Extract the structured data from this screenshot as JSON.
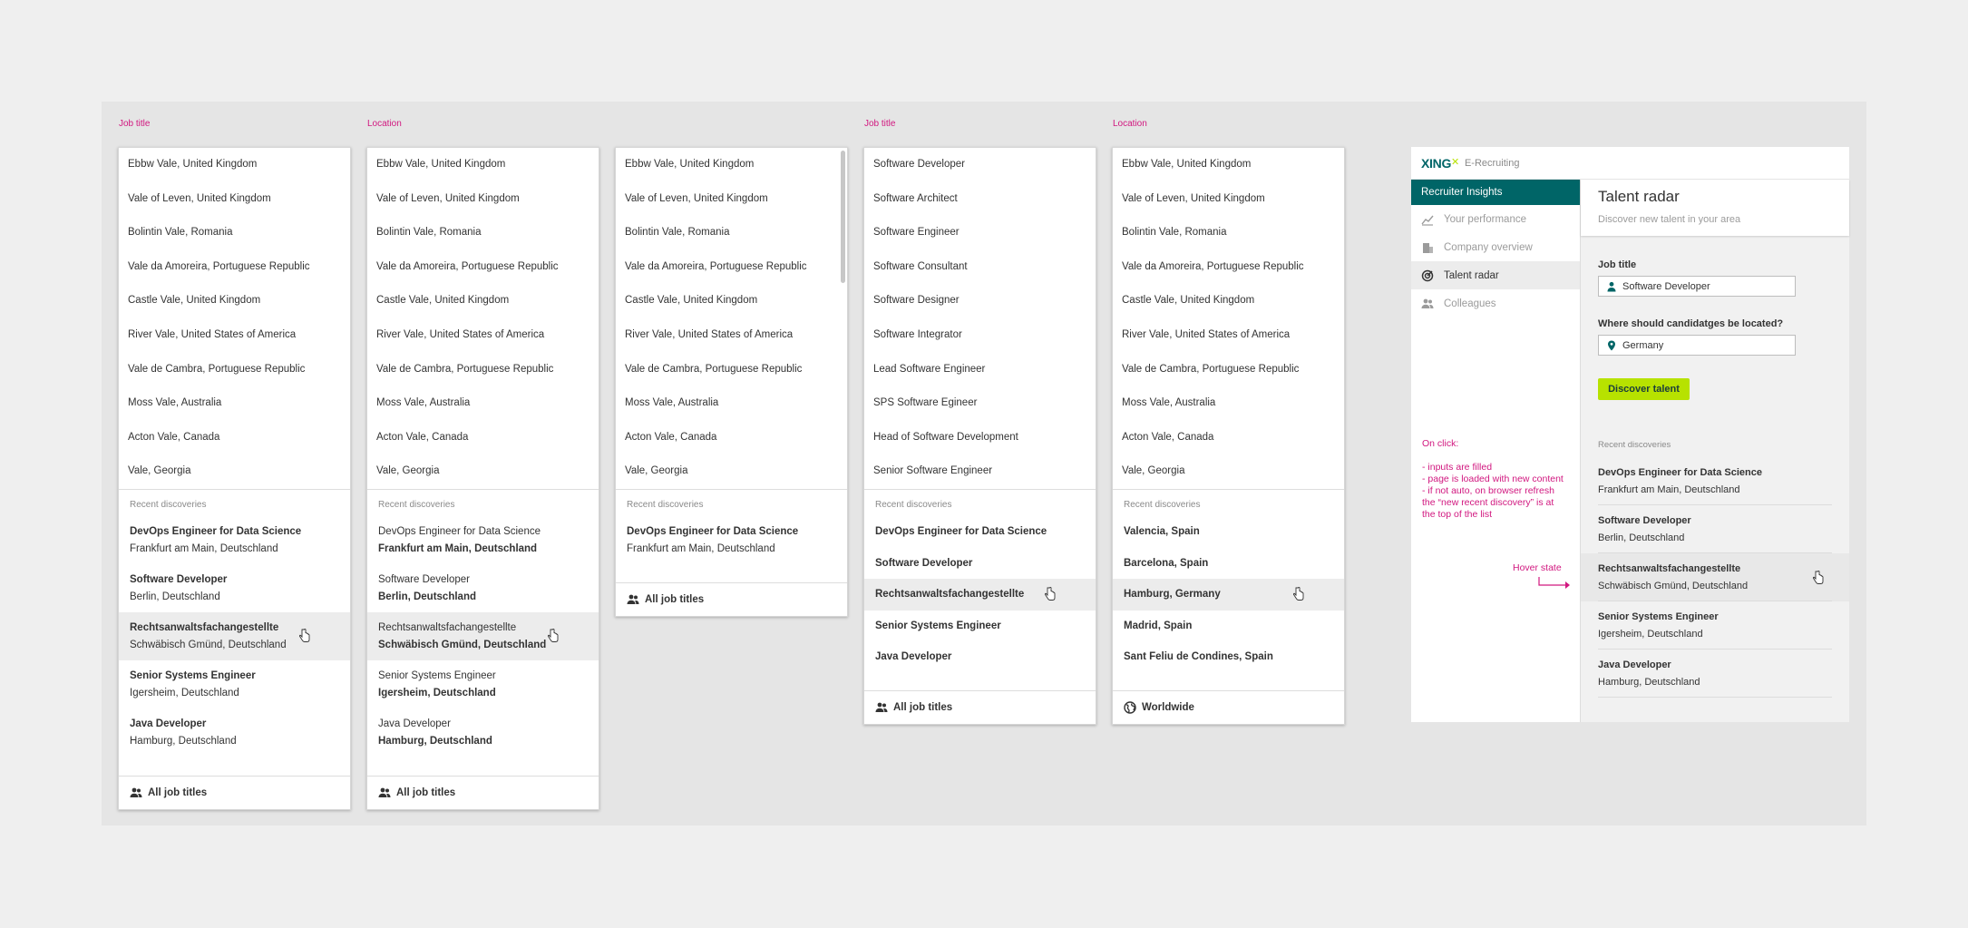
{
  "colors": {
    "annotation": "#d1177f",
    "brand_teal": "#006567",
    "brand_green": "#b7e200"
  },
  "labels": {
    "p1": "Job title",
    "p2": "Location",
    "p4": "Job title",
    "p5": "Location"
  },
  "locations": [
    "Ebbw Vale, United Kingdom",
    "Vale of Leven, United Kingdom",
    "Bolintin Vale, Romania",
    "Vale da Amoreira, Portuguese Republic",
    "Castle Vale, United Kingdom",
    "River Vale, United States of America",
    "Vale de Cambra, Portuguese Republic",
    "Moss Vale, Australia",
    "Acton Vale, Canada",
    "Vale, Georgia"
  ],
  "job_options": [
    "Software Developer",
    "Software Architect",
    "Software Engineer",
    "Software Consultant",
    "Software Designer",
    "Software Integrator",
    "Lead Software Engineer",
    "SPS Software Egineer",
    "Head of Software Development",
    "Senior Software Engineer"
  ],
  "recent_title": "Recent discoveries",
  "recent": [
    {
      "title": "DevOps Engineer for Data Science",
      "place": "Frankfurt am Main, Deutschland"
    },
    {
      "title": "Software Developer",
      "place": "Berlin, Deutschland"
    },
    {
      "title": "Rechtsanwaltsfachangestellte",
      "place": "Schwäbisch Gmünd, Deutschland"
    },
    {
      "title": "Senior Systems Engineer",
      "place": "Igersheim, Deutschland"
    },
    {
      "title": "Java Developer",
      "place": "Hamburg, Deutschland"
    }
  ],
  "recent_jobs_single": [
    "DevOps Engineer for Data Science",
    "Software Developer",
    "Rechtsanwaltsfachangestellte",
    "Senior Systems Engineer",
    "Java Developer"
  ],
  "recent_locations_single": [
    "Valencia, Spain",
    "Barcelona, Spain",
    "Hamburg, Germany",
    "Madrid, Spain",
    "Sant Feliu de Condines, Spain"
  ],
  "footer": {
    "all_jobs": "All job titles",
    "worldwide": "Worldwide"
  },
  "app": {
    "logo": "XING",
    "product": "E-Recruiting",
    "section": "Recruiter Insights",
    "nav": [
      {
        "label": "Your performance",
        "icon": "chart-icon"
      },
      {
        "label": "Company overview",
        "icon": "building-icon"
      },
      {
        "label": "Talent radar",
        "icon": "radar-icon"
      },
      {
        "label": "Colleagues",
        "icon": "people-icon"
      }
    ],
    "title": "Talent radar",
    "subtitle": "Discover new talent in your area",
    "job_label": "Job title",
    "job_value": "Software Developer",
    "loc_label": "Where should candidatges be located?",
    "loc_value": "Germany",
    "button": "Discover talent",
    "recent_title": "Recent discoveries"
  },
  "notes": {
    "onclick": "On click:",
    "l1": "- inputs are filled",
    "l2": "- page is loaded with new content",
    "l3": "- if not auto, on browser refresh the “new recent discovery” is at the top of the list",
    "hover": "Hover state"
  }
}
